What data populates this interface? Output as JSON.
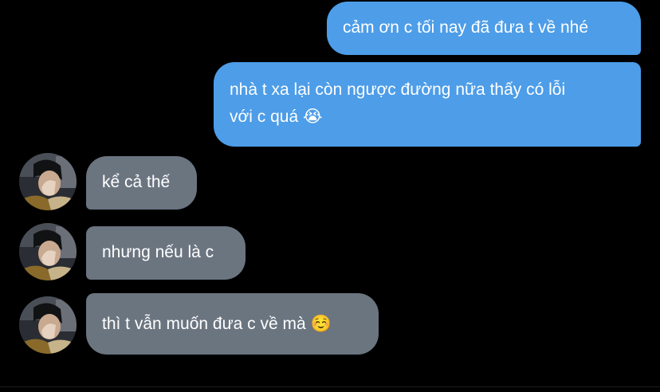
{
  "messages": [
    {
      "direction": "outgoing",
      "text": "cảm ơn c tối nay đã đưa t về nhé"
    },
    {
      "direction": "outgoing",
      "lines": [
        "nhà t xa lại còn ngược đường nữa thấy có lỗi",
        "với c quá 😭"
      ]
    },
    {
      "direction": "incoming",
      "text": "kể cả thế"
    },
    {
      "direction": "incoming",
      "text": "nhưng nếu là c"
    },
    {
      "direction": "incoming",
      "text": "thì t vẫn muốn đưa c về mà ☺️"
    }
  ],
  "colors": {
    "background": "#000000",
    "outgoing_bubble": "#4d9de8",
    "incoming_bubble": "#6b7580",
    "text": "#ffffff"
  },
  "icons": {
    "avatar": "contact-avatar-photo"
  }
}
